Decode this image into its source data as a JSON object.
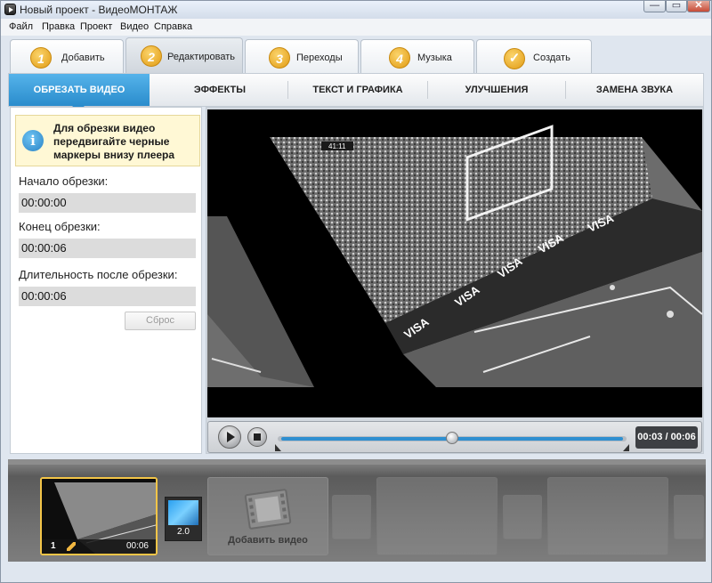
{
  "window": {
    "title": "Новый проект - ВидеоМОНТАЖ",
    "min": "—",
    "max": "▭",
    "close": "✕"
  },
  "menu": [
    "Файл",
    "Правка",
    "Проект",
    "Видео",
    "Справка"
  ],
  "steps": [
    {
      "num": "1",
      "label": "Добавить"
    },
    {
      "num": "2",
      "label": "Редактировать",
      "active": true
    },
    {
      "num": "3",
      "label": "Переходы"
    },
    {
      "num": "4",
      "label": "Музыка"
    },
    {
      "num": "✓",
      "label": "Создать"
    }
  ],
  "subtabs": [
    {
      "label": "Обрезать видео",
      "active": true
    },
    {
      "label": "Эффекты"
    },
    {
      "label": "Текст и графика"
    },
    {
      "label": "Улучшения"
    },
    {
      "label": "Замена звука"
    }
  ],
  "trim_panel": {
    "info_icon": "i",
    "info_text": "Для обрезки видео передвигайте черные маркеры внизу плеера",
    "start_label": "Начало обрезки:",
    "start_value": "00:00:00",
    "end_label": "Конец обрезки:",
    "end_value": "00:00:06",
    "duration_label": "Длительность после обрезки:",
    "duration_value": "00:00:06",
    "reset_label": "Сброс"
  },
  "player": {
    "timecode": "00:03 / 00:06",
    "progress": 0.5,
    "banner_text": "VISA",
    "scoreboard": "41:11"
  },
  "timeline": {
    "clip_number": "1",
    "clip_duration": "00:06",
    "transition_value": "2.0",
    "add_video_label": "Добавить видео"
  }
}
